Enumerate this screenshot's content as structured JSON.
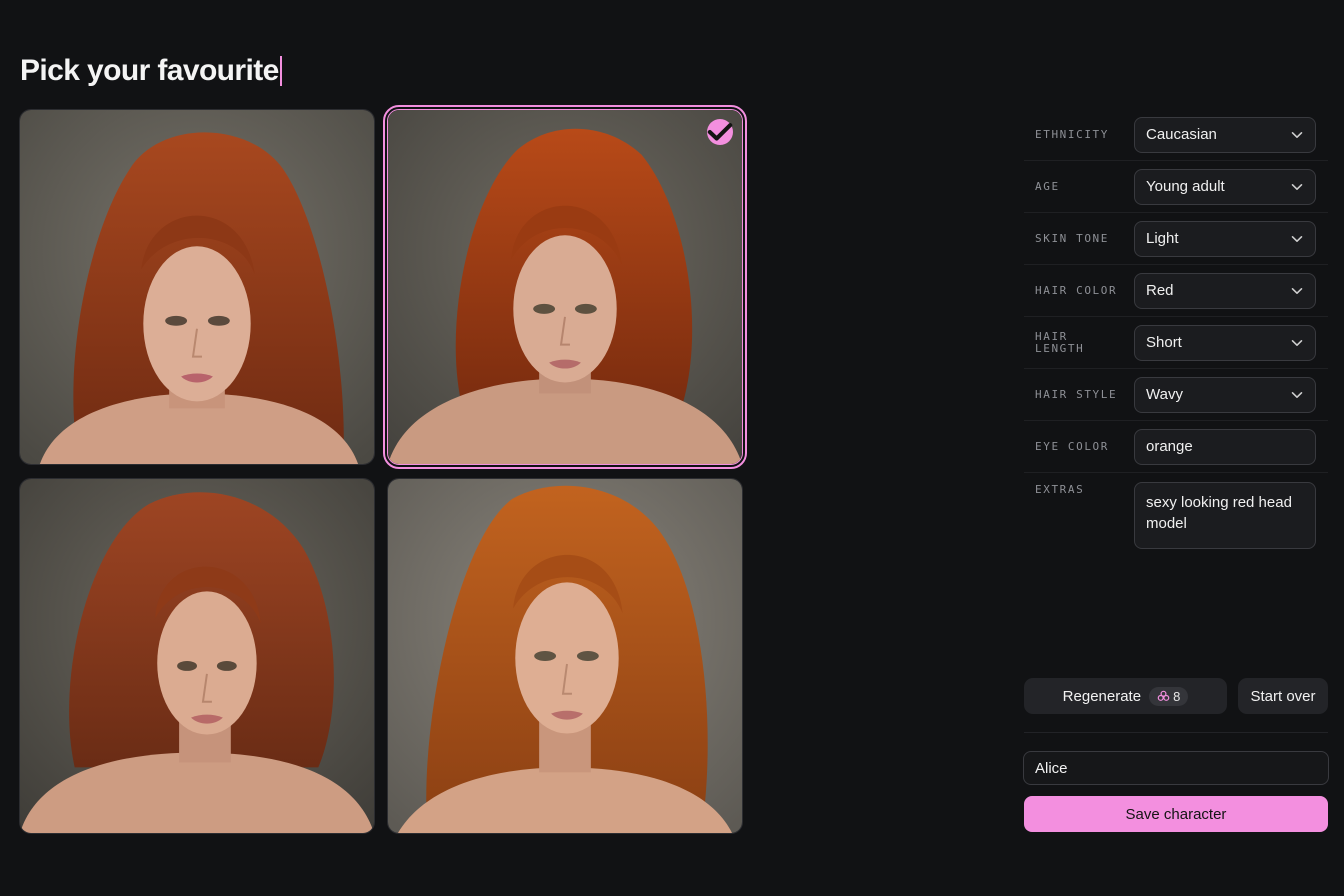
{
  "header": {
    "title": "Pick your favourite"
  },
  "gallery": {
    "accent_color": "#f38fdf",
    "images": [
      {
        "subject": "woman-with-long-wavy-red-hair",
        "selected": false
      },
      {
        "subject": "woman-with-shoulder-length-copper-hair",
        "selected": true
      },
      {
        "subject": "woman-with-voluminous-auburn-hair",
        "selected": false
      },
      {
        "subject": "woman-with-long-ginger-waves",
        "selected": false
      }
    ]
  },
  "attributes": [
    {
      "label": "ETHNICITY",
      "value": "Caucasian",
      "type": "select"
    },
    {
      "label": "AGE",
      "value": "Young adult",
      "type": "select"
    },
    {
      "label": "SKIN TONE",
      "value": "Light",
      "type": "select"
    },
    {
      "label": "HAIR COLOR",
      "value": "Red",
      "type": "select"
    },
    {
      "label": "HAIR LENGTH",
      "value": "Short",
      "type": "select"
    },
    {
      "label": "HAIR STYLE",
      "value": "Wavy",
      "type": "select"
    },
    {
      "label": "EYE COLOR",
      "value": "orange",
      "type": "text"
    },
    {
      "label": "EXTRAS",
      "value": "sexy looking red head model",
      "type": "textarea"
    }
  ],
  "actions": {
    "regenerate_label": "Regenerate",
    "credits": "8",
    "credits_icon": "clover-icon",
    "start_over_label": "Start over"
  },
  "character": {
    "name_value": "Alice",
    "save_label": "Save character"
  },
  "colors": {
    "background": "#111214",
    "accent": "#f38fdf",
    "control_bg": "#1b1c1f",
    "button_bg": "#232428"
  }
}
